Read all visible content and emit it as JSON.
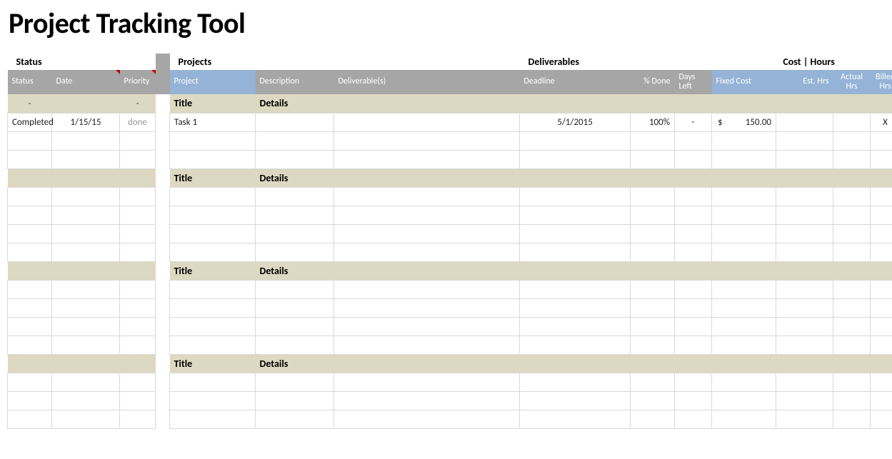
{
  "title": "Project Tracking Tool",
  "groups": {
    "status": "Status",
    "projects": "Projects",
    "deliverables": "Deliverables",
    "cost_hours": "Cost | Hours"
  },
  "headers": {
    "status": "Status",
    "date": "Date",
    "priority": "Priority",
    "project": "Project",
    "description": "Description",
    "deliverable": "Deliverable(s)",
    "deadline": "Deadline",
    "pct_done": "% Done",
    "days_left": "Days Left",
    "fixed_cost": "Fixed Cost",
    "est_hrs": "Est. Hrs",
    "actual_hrs": "Actual Hrs",
    "billed_hrs": "Billed Hrs"
  },
  "section": {
    "dash": "-",
    "title_label": "Title",
    "details_label": "Details"
  },
  "row1": {
    "status": "Completed",
    "date": "1/15/15",
    "priority": "done",
    "project": "Task 1",
    "description": "",
    "deliverable": "",
    "deadline": "5/1/2015",
    "pct_done": "100%",
    "days_left": "-",
    "cost_symbol": "$",
    "cost_value": "150.00",
    "est_hrs": "",
    "actual_hrs": "",
    "billed_hrs": "X"
  }
}
